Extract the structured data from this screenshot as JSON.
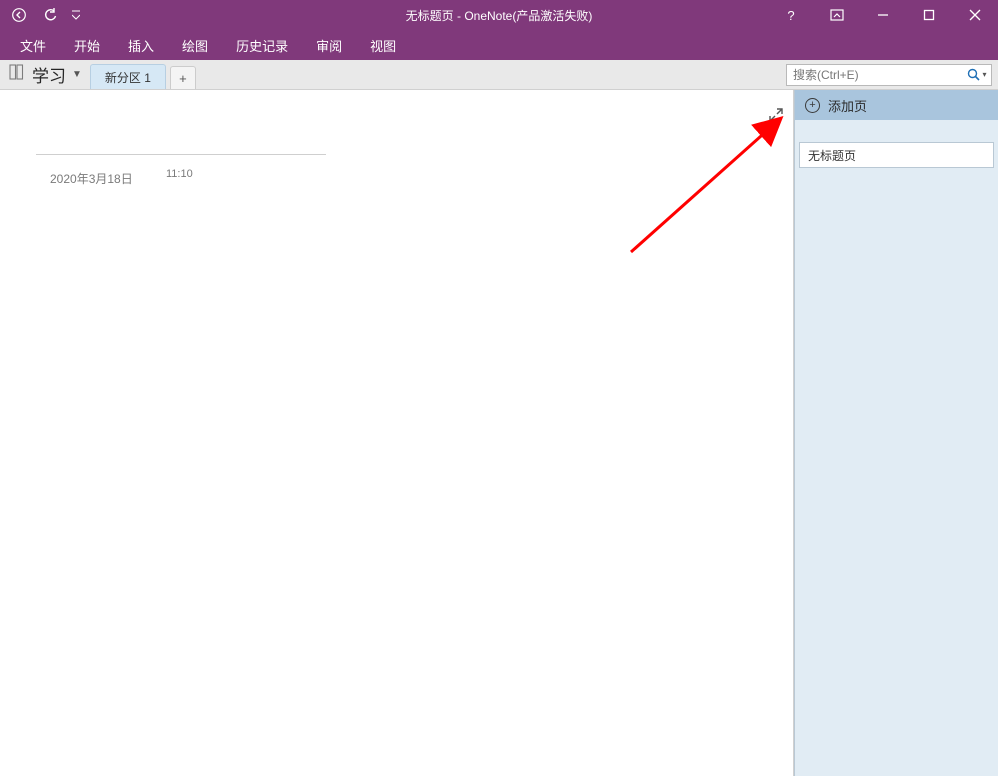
{
  "titlebar": {
    "title": "无标题页 - OneNote(产品激活失败)"
  },
  "menubar": {
    "items": [
      "文件",
      "开始",
      "插入",
      "绘图",
      "历史记录",
      "审阅",
      "视图"
    ]
  },
  "notebook": {
    "name": "学习"
  },
  "section_tab": {
    "label": "新分区 1"
  },
  "search": {
    "placeholder": "搜索(Ctrl+E)"
  },
  "page": {
    "date": "2020年3月18日",
    "time": "11:10"
  },
  "rightpane": {
    "add_label": "添加页",
    "pages": [
      "无标题页"
    ]
  }
}
